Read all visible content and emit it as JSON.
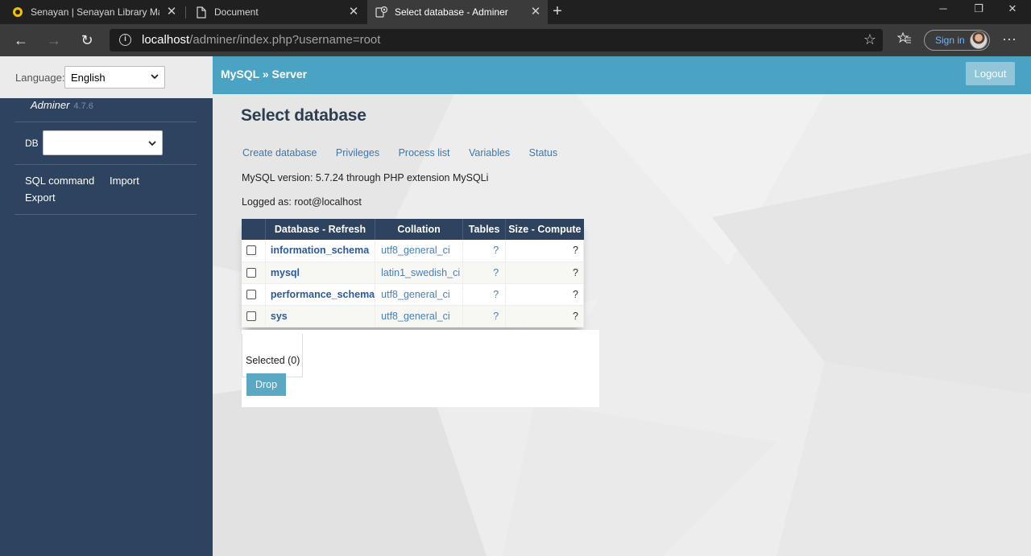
{
  "browser": {
    "tabs": [
      {
        "title": "Senayan | Senayan Library Mana"
      },
      {
        "title": "Document"
      },
      {
        "title": "Select database - Adminer"
      }
    ],
    "url_host": "localhost",
    "url_path": "/adminer/index.php?username=root",
    "signin_label": "Sign in"
  },
  "sidebar": {
    "language_label": "Language:",
    "language_value": "English",
    "app_name": "Adminer",
    "app_version": "4.7.6",
    "db_label": "DB",
    "db_value": "",
    "links": [
      "SQL command",
      "Import",
      "Export"
    ]
  },
  "header": {
    "breadcrumb": "MySQL » Server",
    "logout_label": "Logout"
  },
  "main": {
    "title": "Select database",
    "links": [
      "Create database",
      "Privileges",
      "Process list",
      "Variables",
      "Status"
    ],
    "version_text": "MySQL version: 5.7.24 through PHP extension MySQLi",
    "logged_text": "Logged as: root@localhost",
    "table": {
      "headers": [
        "Database - Refresh",
        "Collation",
        "Tables",
        "Size - Compute"
      ],
      "rows": [
        {
          "name": "information_schema",
          "collation": "utf8_general_ci",
          "tables": "?",
          "size": "?"
        },
        {
          "name": "mysql",
          "collation": "latin1_swedish_ci",
          "tables": "?",
          "size": "?"
        },
        {
          "name": "performance_schema",
          "collation": "utf8_general_ci",
          "tables": "?",
          "size": "?"
        },
        {
          "name": "sys",
          "collation": "utf8_general_ci",
          "tables": "?",
          "size": "?"
        }
      ]
    },
    "selected_label": "Selected (0)",
    "drop_label": "Drop"
  }
}
